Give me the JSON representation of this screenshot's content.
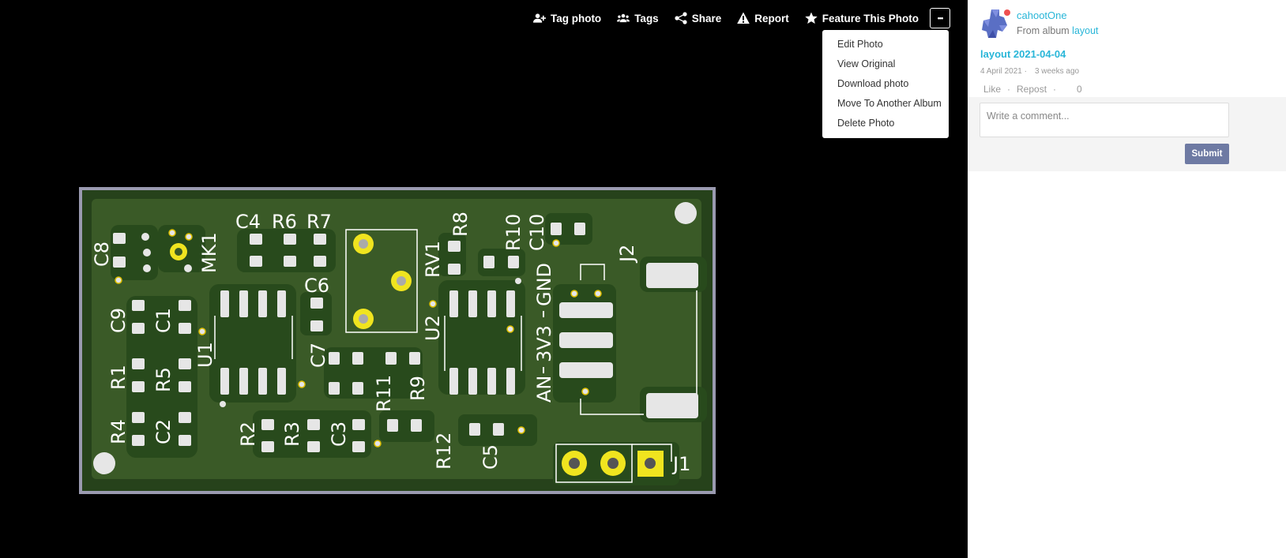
{
  "toolbar": {
    "tag_photo": "Tag photo",
    "tags": "Tags",
    "share": "Share",
    "report": "Report",
    "feature": "Feature This Photo",
    "more": "•••"
  },
  "menu": {
    "items": [
      "Edit Photo",
      "View Original",
      "Download photo",
      "Move To Another Album",
      "Delete Photo"
    ]
  },
  "board": {
    "colors": {
      "board": "#3a5a27",
      "copper": "#2a4a1e",
      "pad": "#e6e6e6",
      "ring": "#f0e41f",
      "frame": "#9a9ab0"
    },
    "labels": [
      "C8",
      "MK1",
      "C4",
      "R6",
      "R7",
      "R8",
      "R10",
      "C10",
      "C6",
      "RV1",
      "C9",
      "C1",
      "U1",
      "C7",
      "U2",
      "GND",
      "3V3",
      "AN",
      "J2",
      "R1",
      "R5",
      "R11",
      "R9",
      "R4",
      "C2",
      "R2",
      "R3",
      "C3",
      "R12",
      "C5",
      "J1"
    ]
  },
  "side": {
    "username": "cahootOne",
    "from_album_prefix": "From album",
    "album": "layout",
    "title": "layout 2021-04-04",
    "date": "4 April 2021 ·",
    "ago": "3 weeks ago",
    "like": "Like",
    "dot1": "·",
    "repost": "Repost",
    "dot2": "·",
    "like_count": "0",
    "comment_placeholder": "Write a comment...",
    "submit": "Submit",
    "accent": "#29b6d8"
  }
}
